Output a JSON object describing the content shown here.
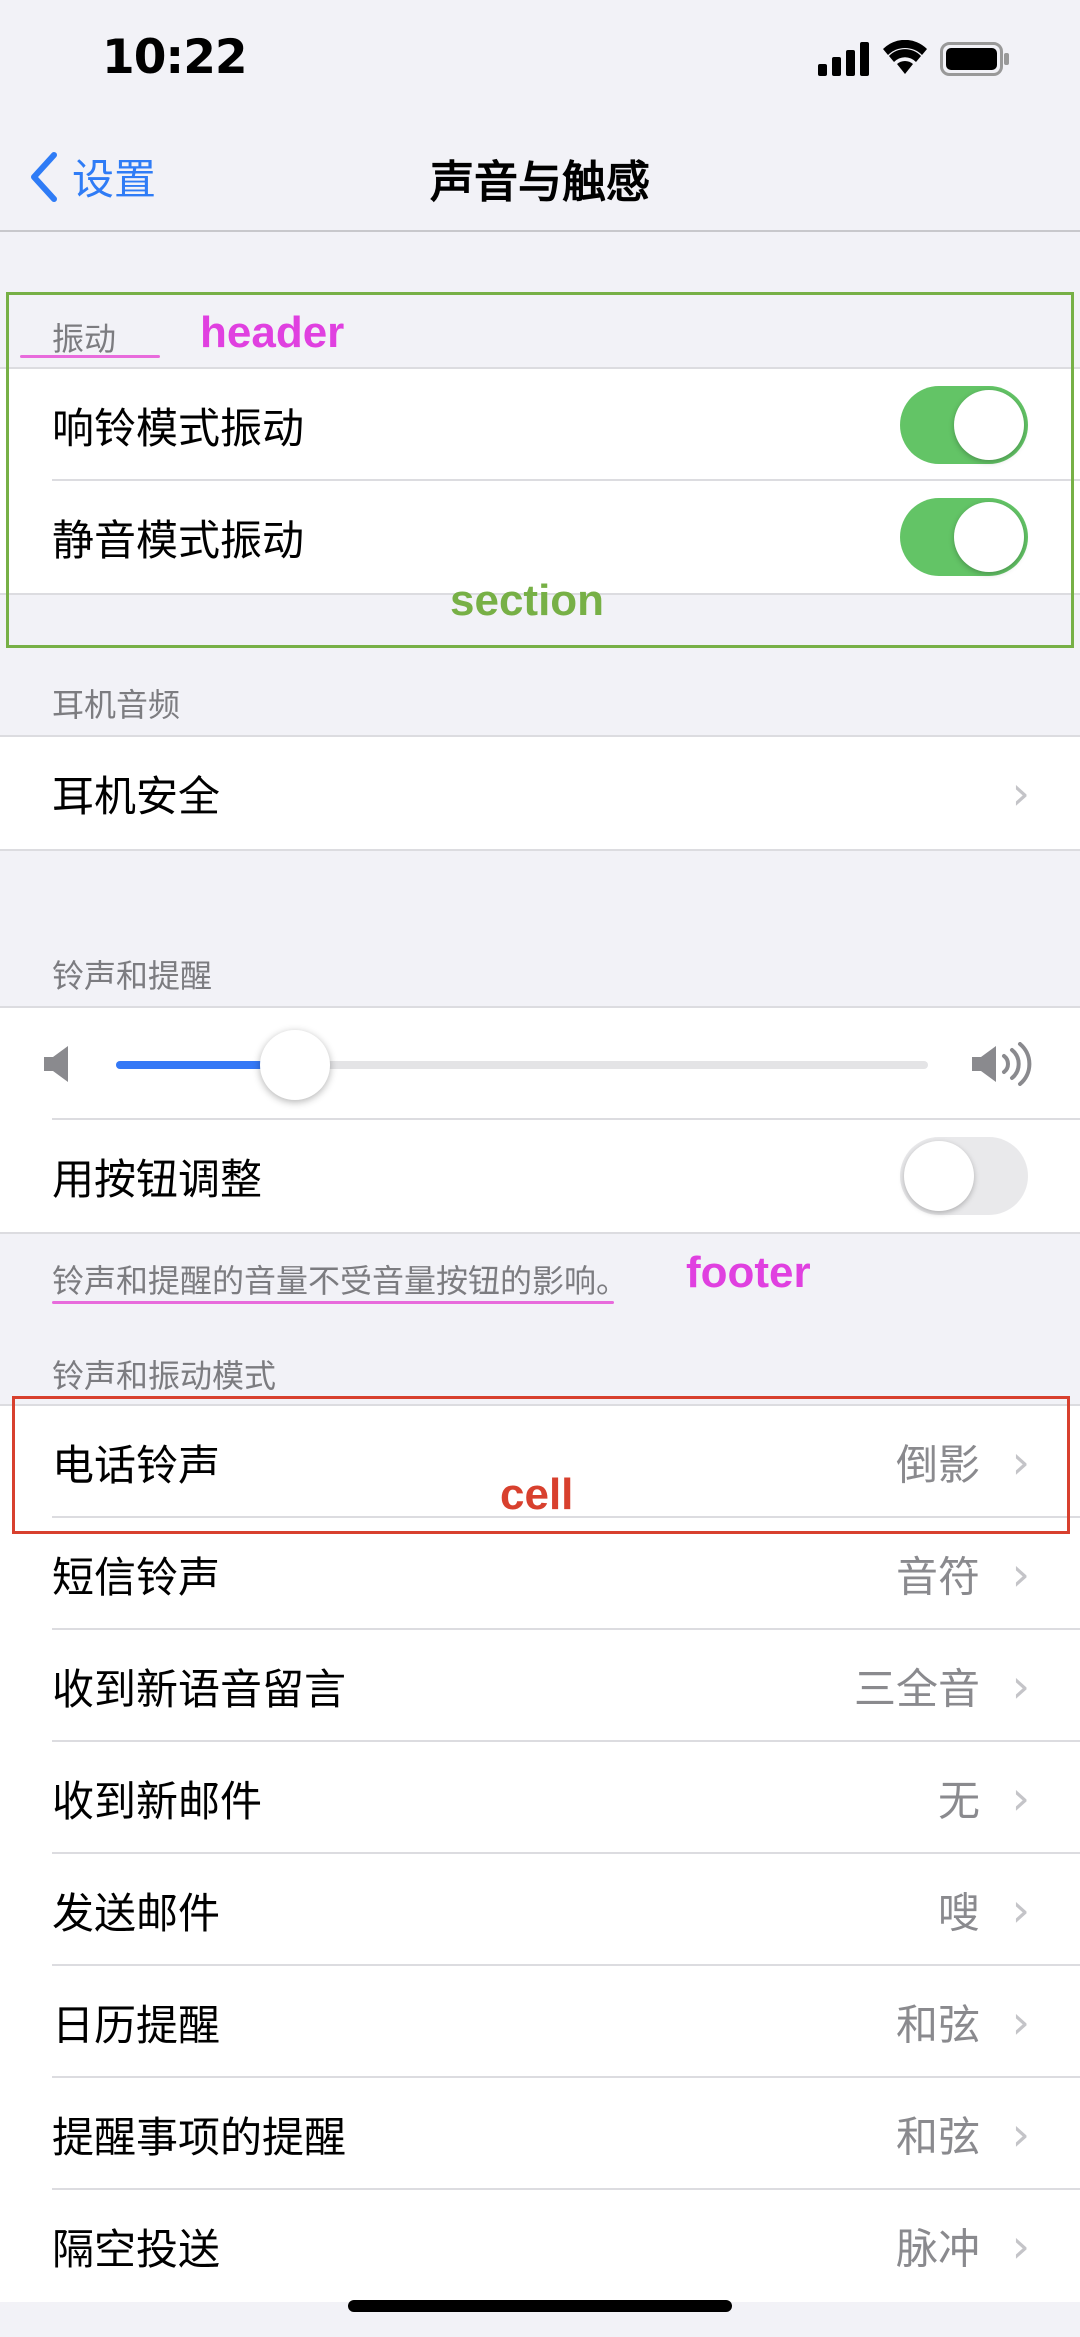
{
  "status_bar": {
    "time": "10:22"
  },
  "nav": {
    "back_label": "设置",
    "title": "声音与触感"
  },
  "vibration": {
    "header": "振动",
    "rows": [
      {
        "label": "响铃模式振动",
        "toggle": "on"
      },
      {
        "label": "静音模式振动",
        "toggle": "on"
      }
    ]
  },
  "headphone": {
    "header": "耳机音频",
    "rows": [
      {
        "label": "耳机安全"
      }
    ]
  },
  "ringer": {
    "header": "铃声和提醒",
    "volume_level": 0.22,
    "button_adjust_label": "用按钮调整",
    "button_adjust_toggle": "off",
    "footer": "铃声和提醒的音量不受音量按钮的影响。"
  },
  "sounds": {
    "header": "铃声和振动模式",
    "rows": [
      {
        "label": "电话铃声",
        "value": "倒影"
      },
      {
        "label": "短信铃声",
        "value": "音符"
      },
      {
        "label": "收到新语音留言",
        "value": "三全音"
      },
      {
        "label": "收到新邮件",
        "value": "无"
      },
      {
        "label": "发送邮件",
        "value": "嗖"
      },
      {
        "label": "日历提醒",
        "value": "和弦"
      },
      {
        "label": "提醒事项的提醒",
        "value": "和弦"
      },
      {
        "label": "隔空投送",
        "value": "脉冲"
      }
    ]
  },
  "annotations": {
    "header": "header",
    "section": "section",
    "footer": "footer",
    "cell": "cell"
  },
  "colors": {
    "accent": "#3478f6",
    "toggle_on": "#63c466",
    "annotation_pink": "#e040e0",
    "annotation_green": "#77b046",
    "annotation_red": "#d8402e"
  }
}
